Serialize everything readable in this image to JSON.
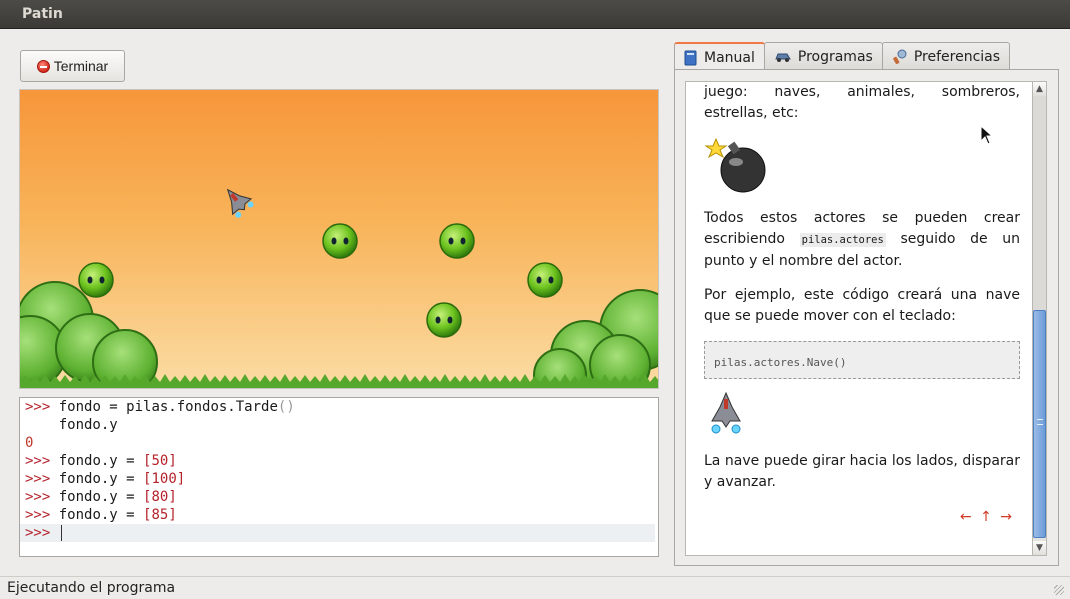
{
  "window": {
    "title": "Patin"
  },
  "toolbar": {
    "stop_label": "Terminar",
    "stop_icon": "stop-icon"
  },
  "console": {
    "prompt": ">>>",
    "lines": [
      {
        "prompt": ">>>",
        "code": "fondo = pilas.fondos.Tarde",
        "suffix": "()"
      },
      {
        "prompt": "",
        "code": "fondo.y",
        "suffix": ""
      },
      {
        "output": "0"
      },
      {
        "prompt": ">>>",
        "code": "fondo.y = ",
        "suffix": "[50]"
      },
      {
        "prompt": ">>>",
        "code": "fondo.y = ",
        "suffix": "[100]"
      },
      {
        "prompt": ">>>",
        "code": "fondo.y = ",
        "suffix": "[80]"
      },
      {
        "prompt": ">>>",
        "code": "fondo.y = ",
        "suffix": "[85]"
      }
    ],
    "current_input": ""
  },
  "tabs": [
    {
      "label": "Manual",
      "icon": "book-icon",
      "active": true
    },
    {
      "label": "Programas",
      "icon": "car-icon",
      "active": false
    },
    {
      "label": "Preferencias",
      "icon": "preferences-icon",
      "active": false
    }
  ],
  "manual": {
    "p1": "juego: naves, animales, sombreros, estrellas, etc:",
    "p2_before": "Todos estos actores se pueden crear escribiendo",
    "p2_code": "pilas.actores",
    "p2_after": "seguido de un punto y el nombre del actor.",
    "p3": "Por ejemplo, este código creará una nave que se puede mover con el teclado:",
    "code_block": "pilas.actores.Nave()",
    "p4": "La nave puede girar hacia los lados, disparar y avanzar.",
    "nav": "← ↑ →"
  },
  "status": {
    "text": "Ejecutando el programa"
  },
  "colors": {
    "accent_tab": "#f07746",
    "sky_top": "#f7963a",
    "sky_bottom": "#fbdca4",
    "bush": "#5cb030",
    "alien": "#6cc21e",
    "prompt": "#b4222b",
    "scroll_thumb": "#6c9bd8"
  }
}
